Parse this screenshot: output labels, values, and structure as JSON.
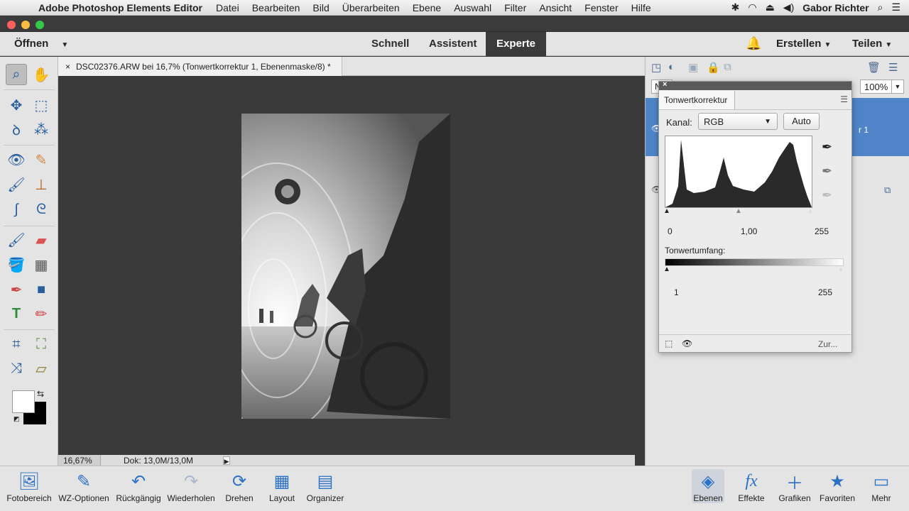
{
  "menubar": {
    "app_name": "Adobe Photoshop Elements Editor",
    "items": [
      "Datei",
      "Bearbeiten",
      "Bild",
      "Überarbeiten",
      "Ebene",
      "Auswahl",
      "Filter",
      "Ansicht",
      "Fenster",
      "Hilfe"
    ],
    "user": "Gabor Richter"
  },
  "toolbar": {
    "open_label": "Öffnen",
    "modes": [
      "Schnell",
      "Assistent",
      "Experte"
    ],
    "active_mode": "Experte",
    "create_label": "Erstellen",
    "share_label": "Teilen"
  },
  "document": {
    "tab_title": "DSC02376.ARW bei 16,7% (Tonwertkorrektur 1, Ebenenmaske/8) *",
    "zoom": "16,67%",
    "doc_size": "Dok: 13,0M/13,0M"
  },
  "layers_panel": {
    "blend_mode_short": "N",
    "opacity": "100%",
    "layer_label_partial": "r 1"
  },
  "levels_dialog": {
    "title": "Tonwertkorrektur",
    "channel_label": "Kanal:",
    "channel_value": "RGB",
    "auto_button": "Auto",
    "input_black": "0",
    "input_gamma": "1,00",
    "input_white": "255",
    "output_label": "Tonwertumfang:",
    "output_black": "1",
    "output_white": "255",
    "footer_link": "Zur..."
  },
  "taskbar": {
    "left": [
      "Fotobereich",
      "WZ-Optionen",
      "Rückgängig",
      "Wiederholen",
      "Drehen",
      "Layout",
      "Organizer"
    ],
    "right": [
      "Ebenen",
      "Effekte",
      "Grafiken",
      "Favoriten",
      "Mehr"
    ]
  }
}
